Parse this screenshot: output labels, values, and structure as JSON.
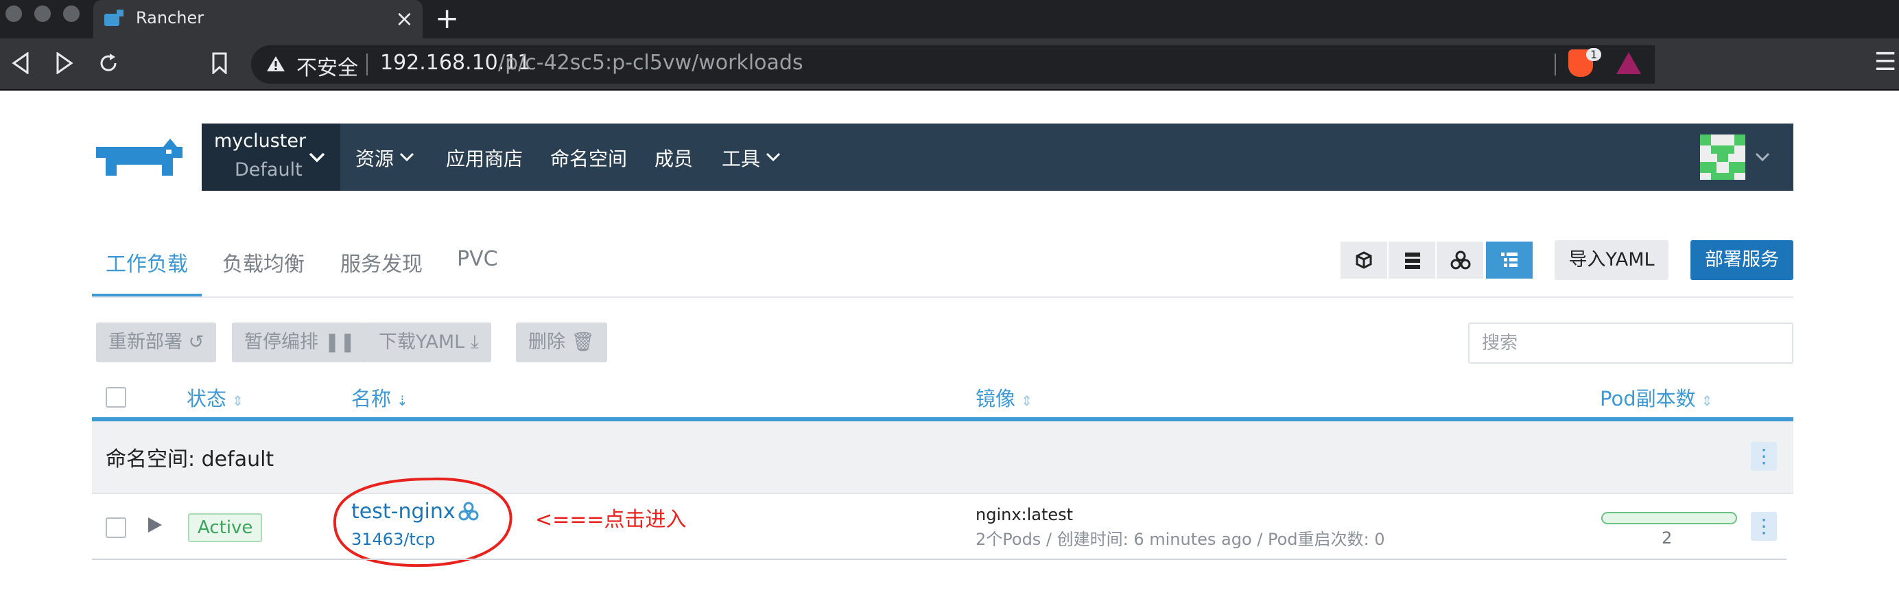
{
  "browser": {
    "tab_title": "Rancher",
    "insecure_label": "不安全",
    "url_host": "192.168.10.11",
    "url_path": "/p/c-42sc5:p-cl5vw/workloads",
    "shields_count": "1"
  },
  "header": {
    "cluster_name": "mycluster",
    "project_name": "Default",
    "nav": [
      "资源",
      "应用商店",
      "命名空间",
      "成员",
      "工具"
    ]
  },
  "subtabs": [
    "工作负载",
    "负载均衡",
    "服务发现",
    "PVC"
  ],
  "view_icons": [
    "cube-icon",
    "server-list-icon",
    "workload-group-icon",
    "flat-list-icon"
  ],
  "buttons": {
    "import_yaml": "导入YAML",
    "deploy": "部署服务"
  },
  "actions": {
    "redeploy": "重新部署",
    "pause": "暂停编排",
    "download_yaml": "下载YAML",
    "delete": "删除"
  },
  "search": {
    "placeholder": "搜索"
  },
  "table": {
    "headers": [
      "状态",
      "名称",
      "镜像",
      "Pod副本数"
    ],
    "namespace_group": "命名空间: default",
    "rows": [
      {
        "status": "Active",
        "name": "test-nginx",
        "port": "31463/tcp",
        "image": "nginx:latest",
        "meta": "2个Pods / 创建时间: 6 minutes ago / Pod重启次数: 0",
        "pods": "2"
      }
    ]
  },
  "annotation": "<===点击进入",
  "colors": {
    "accent": "#3d98d3",
    "primary_button": "#1c75b8",
    "nav_bg": "#2b3f52",
    "cluster_bg": "#1e2d3b",
    "active_green": "#3aa55a",
    "annotation_red": "#e8231d"
  }
}
